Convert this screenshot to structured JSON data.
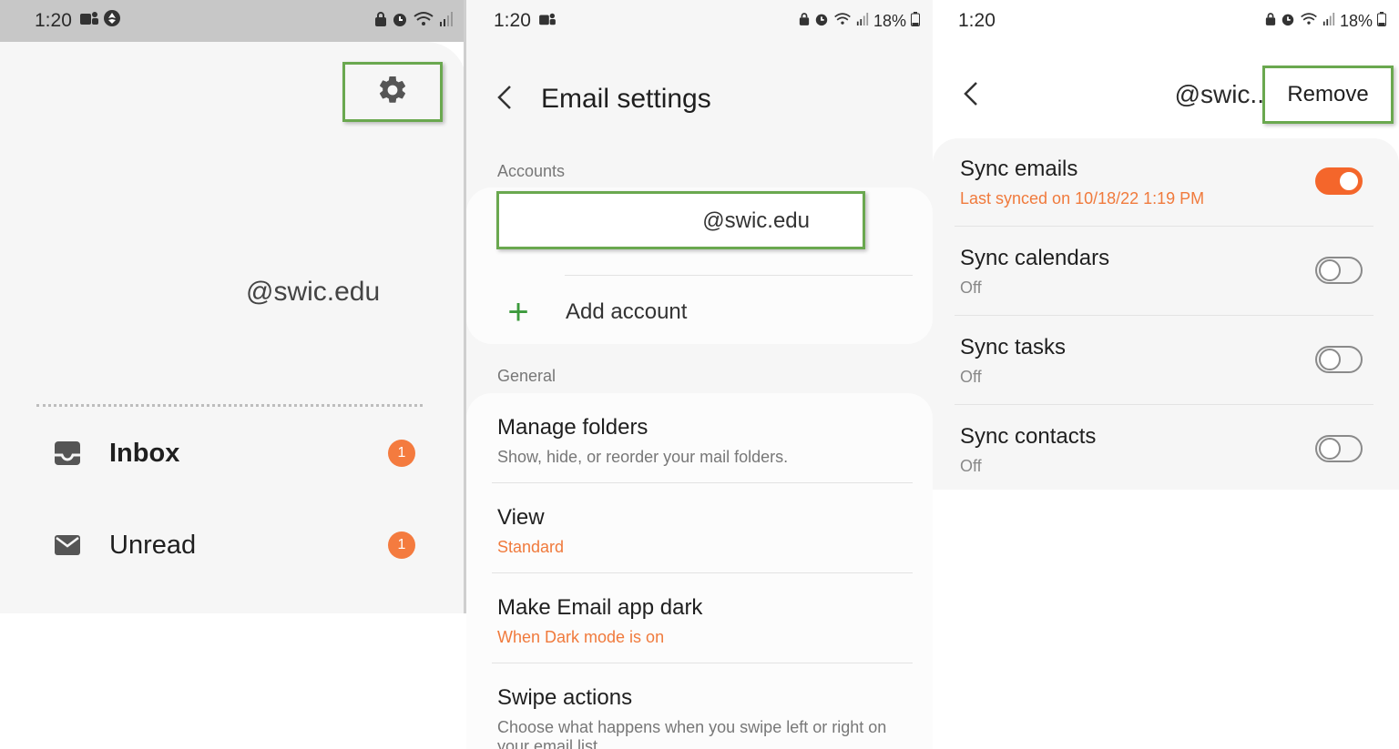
{
  "panel1": {
    "status": {
      "time": "1:20"
    },
    "account_email": "@swic.edu",
    "nav": [
      {
        "label": "Inbox",
        "badge": "1"
      },
      {
        "label": "Unread",
        "badge": "1"
      }
    ]
  },
  "panel2": {
    "status": {
      "time": "1:20",
      "battery": "18%"
    },
    "title": "Email settings",
    "accounts_label": "Accounts",
    "account_email": "@swic.edu",
    "add_account": "Add account",
    "general_label": "General",
    "settings": [
      {
        "title": "Manage folders",
        "subtitle": "Show, hide, or reorder your mail folders."
      },
      {
        "title": "View",
        "subtitle": "Standard"
      },
      {
        "title": "Make Email app dark",
        "subtitle": "When Dark mode is on"
      },
      {
        "title": "Swipe actions",
        "subtitle": "Choose what happens when you swipe left or right on your email list."
      }
    ]
  },
  "panel3": {
    "status": {
      "time": "1:20",
      "battery": "18%"
    },
    "account_name": "@swic..",
    "remove_label": "Remove",
    "sync": [
      {
        "title": "Sync emails",
        "subtitle": "Last synced on 10/18/22  1:19 PM",
        "on": true
      },
      {
        "title": "Sync calendars",
        "subtitle": "Off",
        "on": false
      },
      {
        "title": "Sync tasks",
        "subtitle": "Off",
        "on": false
      },
      {
        "title": "Sync contacts",
        "subtitle": "Off",
        "on": false
      }
    ]
  },
  "colors": {
    "accent_orange": "#f4662b",
    "highlight_green": "#6aa84f",
    "add_green": "#3c9a3c"
  }
}
